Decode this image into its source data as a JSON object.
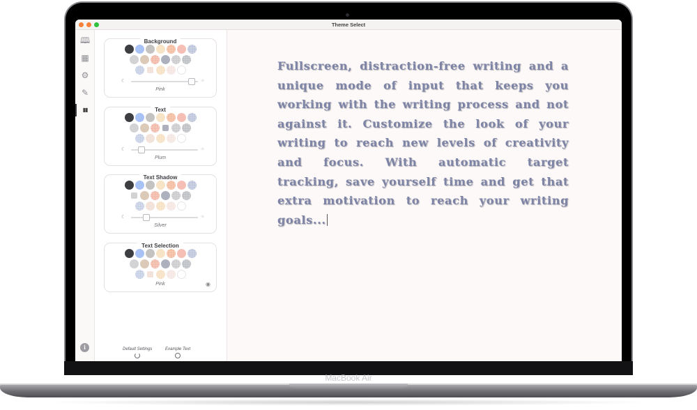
{
  "device": {
    "brand_label": "MacBook Air"
  },
  "window": {
    "title": "Theme Select",
    "traffic_lights": {
      "close": "#f7803a",
      "minimize": "#f7803a",
      "zoom": "#30c13d"
    }
  },
  "icon_bar": {
    "items": [
      {
        "name": "book-icon",
        "glyph": "🕮",
        "active": false
      },
      {
        "name": "calendar-icon",
        "glyph": "▦",
        "active": false
      },
      {
        "name": "gear-icon",
        "glyph": "⚙",
        "active": false
      },
      {
        "name": "edit-icon",
        "glyph": "✎",
        "active": false
      },
      {
        "name": "books-icon",
        "glyph": "▮▮",
        "active": true
      }
    ],
    "info_glyph": "i"
  },
  "palette": {
    "row1": [
      {
        "color": "#3d3e42",
        "dotted": false
      },
      {
        "color": "#a9c2f5",
        "dotted": false
      },
      {
        "color": "#c5c3c1",
        "dotted": false
      },
      {
        "color": "#f7e3c6",
        "dotted": false
      },
      {
        "color": "#f3b89a",
        "dotted": true
      },
      {
        "color": "#f6bfb6",
        "dotted": false
      },
      {
        "color": "#b9c2da",
        "dotted": true
      }
    ],
    "row2": [
      {
        "color": "#d3d3d5",
        "dotted": false
      },
      {
        "color": "#dccab8",
        "dotted": false
      },
      {
        "color": "#f2b5a4",
        "dotted": true
      },
      {
        "color": "#adb1bd",
        "dotted": false
      },
      {
        "color": "#c8c8cb",
        "dotted": true
      },
      {
        "color": "#b9bcc1",
        "dotted": true
      }
    ],
    "row3": [
      {
        "color": "#c3cde3",
        "dotted": true
      },
      {
        "color": "#f0ddd3",
        "dotted": true
      },
      {
        "color": "#f6dfbf",
        "dotted": true
      },
      {
        "color": "#f5e5e0",
        "dotted": true
      },
      {
        "color": "#ffffff",
        "dotted": false
      }
    ]
  },
  "panels": [
    {
      "title": "Background",
      "caption": "Pink",
      "slider_value": 0.95,
      "selected_row": 3,
      "selected_index": 1,
      "has_slider": true,
      "has_eye": false
    },
    {
      "title": "Text",
      "caption": "Plum",
      "slider_value": 0.12,
      "selected_row": 2,
      "selected_index": 3,
      "has_slider": true,
      "has_eye": false
    },
    {
      "title": "Text Shadow",
      "caption": "Silver",
      "slider_value": 0.2,
      "selected_row": 2,
      "selected_index": 0,
      "has_slider": true,
      "has_eye": false
    },
    {
      "title": "Text Selection",
      "caption": "Pink",
      "slider_value": null,
      "selected_row": 3,
      "selected_index": 1,
      "has_slider": false,
      "has_eye": true
    }
  ],
  "footer": {
    "default_settings_label": "Default Settings",
    "example_text_label": "Example Text"
  },
  "editor": {
    "text": "Fullscreen, distraction-free writing and a unique mode of input that keeps you working with the writing process and not against it. Customize the look of your writing to reach new levels of creativity and focus. With automatic target tracking, save yourself time and get that extra motivation to reach your writing goals..."
  }
}
